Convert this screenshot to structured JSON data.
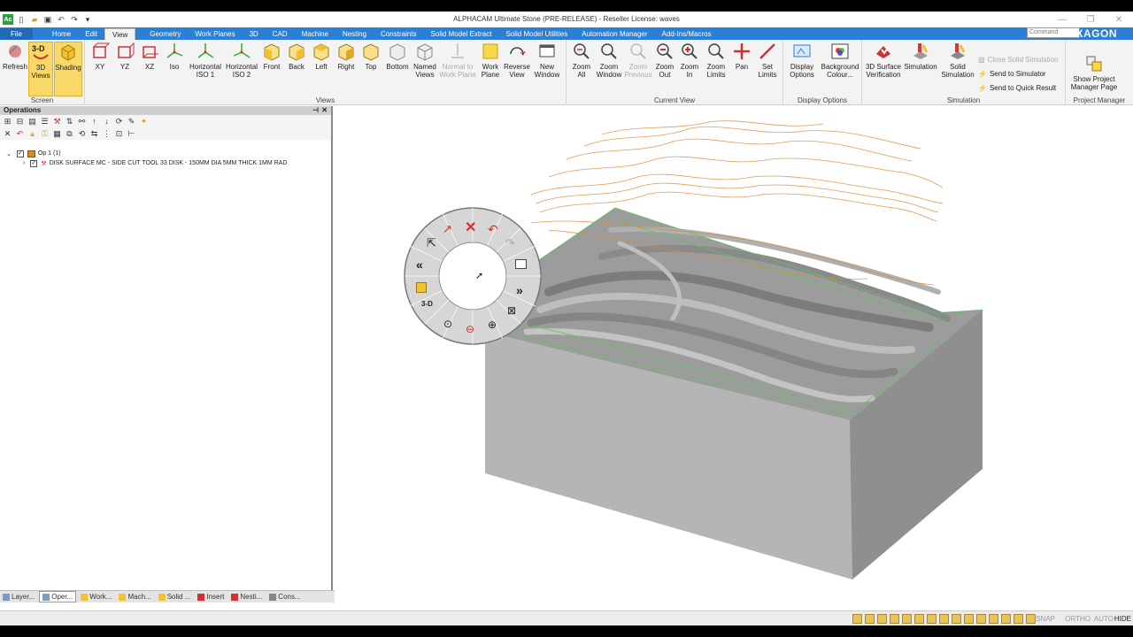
{
  "window": {
    "title": "ALPHACAM Ultimate Stone (PRE-RELEASE) - Reseller License: waves",
    "app_logo": "Ac"
  },
  "menu": {
    "tabs": [
      "File",
      "Home",
      "Edit",
      "View",
      "Geometry",
      "Work Planes",
      "3D",
      "CAD",
      "Machine",
      "Nesting",
      "Constraints",
      "Solid Model Extract",
      "Solid Model Utilities",
      "Automation Manager",
      "Add-Ins/Macros"
    ],
    "active": "View",
    "search_placeholder": "Command Search",
    "brand": "HEXAGON"
  },
  "ribbon": {
    "screen": {
      "label": "Screen",
      "refresh": "Refresh",
      "views3d": "3D Views",
      "shading": "Shading"
    },
    "views": {
      "label": "Views",
      "xy": "XY",
      "yz": "YZ",
      "xz": "XZ",
      "iso": "Iso",
      "hiso1": "Horizontal ISO 1",
      "hiso2": "Horizontal ISO 2",
      "front": "Front",
      "back": "Back",
      "left": "Left",
      "right": "Right",
      "top": "Top",
      "bottom": "Bottom",
      "named": "Named Views",
      "normal": "Normal to Work Plane",
      "workplane": "Work Plane",
      "reverse": "Reverse View",
      "newwin": "New Window"
    },
    "current_view": {
      "label": "Current View",
      "zoomall": "Zoom All",
      "zoomwin": "Zoom Window",
      "zoomprev": "Zoom Previous",
      "zoomout": "Zoom Out",
      "zoomin": "Zoom In",
      "zoomlim": "Zoom Limits",
      "pan": "Pan",
      "setlim": "Set Limits"
    },
    "display": {
      "label": "Display Options",
      "opts": "Display Options",
      "bg": "Background Colour..."
    },
    "simulation": {
      "label": "Simulation",
      "verif": "3D Surface Verification",
      "sim": "Simulation",
      "solid": "Solid Simulation",
      "close": "Close Solid Simulation",
      "send": "Send to Simulator",
      "quick": "Send to Quick Result"
    },
    "project": {
      "label": "Project Manager",
      "show": "Show Project Manager Page"
    }
  },
  "operations": {
    "title": "Operations",
    "root": "Op 1  (1)",
    "child": "DISK SURFACE MC - SIDE CUT   TOOL 33   DISK - 150MM DIA 5MM THICK 1MM RAD"
  },
  "bottom_tabs": [
    "Layer...",
    "Oper...",
    "Work...",
    "Mach...",
    "Solid ...",
    "Insert",
    "Nesti...",
    "Cons..."
  ],
  "status": {
    "snap": "SNAP",
    "ortho": "ORTHO",
    "auto": "AUTO",
    "hide": "HIDE"
  },
  "radial_menu": {
    "label3d": "3-D"
  },
  "colors": {
    "accent": "#2b7fd4",
    "toolpath_orange": "#d98a3a",
    "toolpath_green": "#5cc45c",
    "stone": "#a8a8a8"
  }
}
